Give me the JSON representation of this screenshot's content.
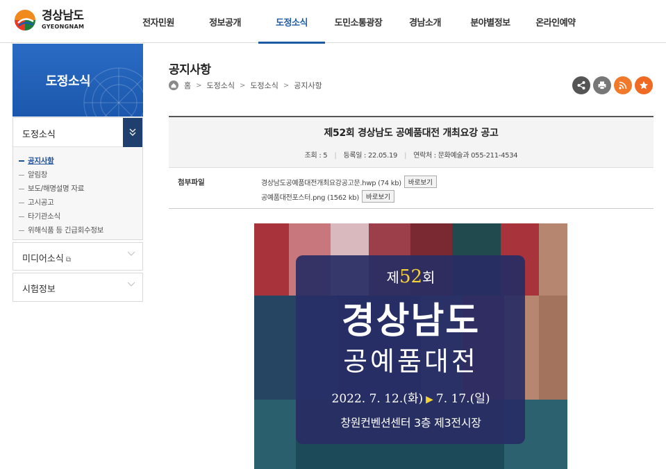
{
  "logo": {
    "name": "경상남도",
    "sub": "GYEONGNAM"
  },
  "gnb": [
    {
      "label": "전자민원",
      "active": false
    },
    {
      "label": "정보공개",
      "active": false
    },
    {
      "label": "도정소식",
      "active": true
    },
    {
      "label": "도민소통광장",
      "active": false
    },
    {
      "label": "경남소개",
      "active": false
    },
    {
      "label": "분야별정보",
      "active": false
    },
    {
      "label": "온라인예약",
      "active": false
    }
  ],
  "sidebar": {
    "title": "도정소식",
    "menu1": {
      "label": "도정소식",
      "items": [
        {
          "label": "공지사항",
          "active": true
        },
        {
          "label": "알림창",
          "active": false
        },
        {
          "label": "보도/해명설명 자료",
          "active": false
        },
        {
          "label": "고시공고",
          "active": false
        },
        {
          "label": "타기관소식",
          "active": false
        },
        {
          "label": "위해식품 등 긴급회수정보",
          "active": false
        }
      ]
    },
    "menu2": {
      "label": "미디어소식"
    },
    "menu3": {
      "label": "시험정보"
    }
  },
  "page": {
    "title": "공지사항",
    "breadcrumb": [
      "홈",
      "도정소식",
      "도정소식",
      "공지사항"
    ]
  },
  "utility_icons": [
    "share-icon",
    "print-icon",
    "rss-icon",
    "star-icon"
  ],
  "post": {
    "title": "제52회 경상남도 공예품대전 개최요강 공고",
    "views": "조회 : 5",
    "date": "등록일 : 22.05.19",
    "contact": "연락처 : 문화예술과 055-211-4534"
  },
  "attachments": {
    "label": "첨부파일",
    "view_label": "바로보기",
    "files": [
      {
        "name": "경상남도공예품대전개최요강공고문.hwp (74 kb)"
      },
      {
        "name": "공예품대전포스터.png (1562 kb)"
      }
    ]
  },
  "poster": {
    "edition_pre": "제",
    "edition_num": "52",
    "edition_post": "회",
    "title1": "경상남도",
    "title2": "공예품대전",
    "date_start": "2022. 7. 12.(화)",
    "date_end": "7. 17.(일)",
    "venue": "창원컨벤션센터 3층 제3전시장"
  },
  "colors": {
    "accent": "#1c5aa6",
    "sidebar_bg": "#1f5cb2",
    "toggle_bg": "#1f3f6e",
    "share": "#555555",
    "print": "#777777",
    "rss": "#f07a2a",
    "star": "#f06a23"
  }
}
